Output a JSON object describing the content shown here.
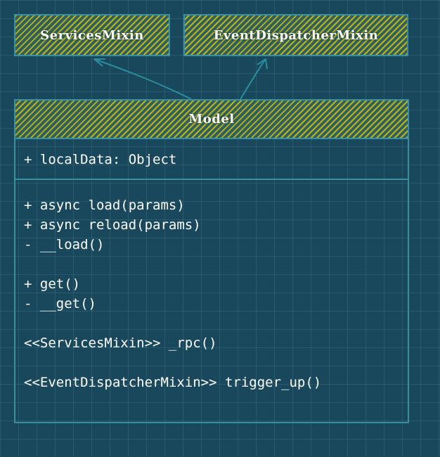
{
  "classes": {
    "services_mixin": {
      "name": "ServicesMixin"
    },
    "event_dispatcher_mixin": {
      "name": "EventDispatcherMixin"
    },
    "model": {
      "name": "Model",
      "attributes": [
        "+ localData: Object"
      ],
      "methods": [
        "+ async load(params)",
        "+ async reload(params)",
        "- __load()",
        "",
        "+ get()",
        "- __get()",
        "",
        "<<ServicesMixin>> _rpc()",
        "",
        "<<EventDispatcherMixin>> trigger_up()"
      ]
    }
  },
  "relations": [
    {
      "from": "Model",
      "to": "ServicesMixin",
      "type": "inheritance"
    },
    {
      "from": "Model",
      "to": "EventDispatcherMixin",
      "type": "inheritance"
    }
  ],
  "colors": {
    "background": "#19485c",
    "border": "#3a8fa0",
    "hatch": "#b8b21e",
    "text": "#ffffff"
  }
}
